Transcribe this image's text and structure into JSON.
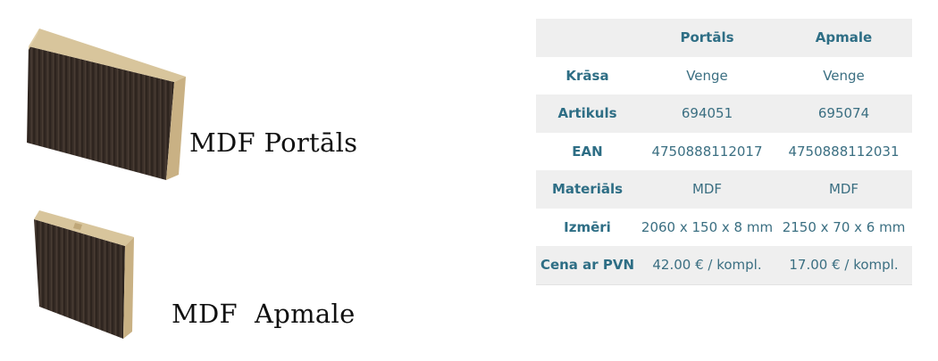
{
  "products": [
    {
      "name": "MDF Portāls",
      "image_icon": "wood-board-wide-icon"
    },
    {
      "name": "MDF  Apmale",
      "image_icon": "wood-board-trim-icon"
    }
  ],
  "spec_table": {
    "columns": [
      "",
      "Portāls",
      "Apmale"
    ],
    "rows": [
      {
        "label": "Krāsa",
        "values": [
          "Venge",
          "Venge"
        ]
      },
      {
        "label": "Artikuls",
        "values": [
          "694051",
          "695074"
        ]
      },
      {
        "label": "EAN",
        "values": [
          "4750888112017",
          "4750888112031"
        ]
      },
      {
        "label": "Materiāls",
        "values": [
          "MDF",
          "MDF"
        ]
      },
      {
        "label": "Izmēri",
        "values": [
          "2060 x 150 x 8 mm",
          "2150 x 70 x 6 mm"
        ]
      },
      {
        "label": "Cena ar PVN",
        "values": [
          "42.00 € / kompl.",
          "17.00 € / kompl."
        ]
      }
    ]
  },
  "colors": {
    "header_text": "#2e6e85",
    "cell_text": "#3b6f82",
    "row_shade": "#efefef",
    "wood_dark": "#3a2f28",
    "wood_edge": "#d8c59c"
  }
}
